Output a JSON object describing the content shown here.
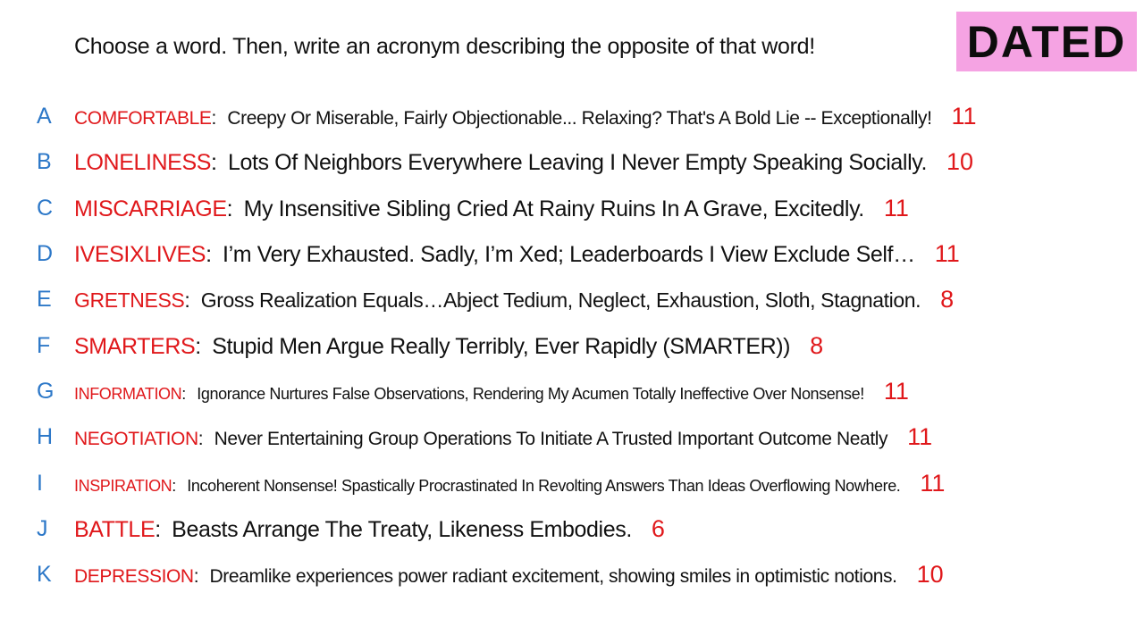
{
  "prompt": "Choose a word. Then, write an acronym describing the opposite of that word!",
  "badge": {
    "text": "DATED",
    "color": "#f5a3e3"
  },
  "colors": {
    "letter": "#2d78c8",
    "word": "#e0181b",
    "score": "#e0181b",
    "text": "#111111"
  },
  "entries": [
    {
      "letter": "A",
      "word": "COMFORTABLE",
      "colon": ":",
      "phrase": "Creepy Or Miserable, Fairly Objectionable... Relaxing? That's A Bold Lie -- Exceptionally!",
      "score": "11"
    },
    {
      "letter": "B",
      "word": "LONELINESS",
      "colon": ":",
      "phrase": "Lots Of Neighbors Everywhere Leaving I Never Empty Speaking Socially.",
      "score": "10"
    },
    {
      "letter": "C",
      "word": "MISCARRIAGE",
      "colon": ":",
      "phrase": "My Insensitive Sibling Cried At Rainy Ruins In A Grave, Excitedly.",
      "score": "11"
    },
    {
      "letter": "D",
      "word": "IVESIXLIVES",
      "colon": ":",
      "phrase": "I’m Very Exhausted. Sadly, I’m Xed; Leaderboards I View Exclude Self…",
      "score": "11"
    },
    {
      "letter": "E",
      "word": "GRETNESS",
      "colon": ":",
      "phrase": "Gross Realization Equals…Abject Tedium, Neglect, Exhaustion, Sloth, Stagnation.",
      "score": "8"
    },
    {
      "letter": "F",
      "word": "SMARTERS",
      "colon": ":",
      "phrase": "Stupid Men Argue Really Terribly, Ever Rapidly  (SMARTER))",
      "score": "8"
    },
    {
      "letter": "G",
      "word": "INFORMATION",
      "colon": ":",
      "phrase": "Ignorance Nurtures False Observations, Rendering My Acumen Totally Ineffective Over Nonsense!",
      "score": "11"
    },
    {
      "letter": "H",
      "word": "NEGOTIATION",
      "colon": ":",
      "phrase": "Never Entertaining Group Operations To Initiate A Trusted Important Outcome Neatly",
      "score": "11"
    },
    {
      "letter": "I",
      "word": "INSPIRATION",
      "colon": ":",
      "phrase": "Incoherent Nonsense! Spastically Procrastinated In Revolting Answers Than Ideas Overflowing Nowhere.",
      "score": "11"
    },
    {
      "letter": "J",
      "word": "BATTLE",
      "colon": ":",
      "phrase": "Beasts Arrange The Treaty, Likeness Embodies.",
      "score": "6"
    },
    {
      "letter": "K",
      "word": "DEPRESSION",
      "colon": ":",
      "phrase": "Dreamlike experiences power radiant excitement, showing smiles in optimistic notions.",
      "score": "10"
    }
  ]
}
